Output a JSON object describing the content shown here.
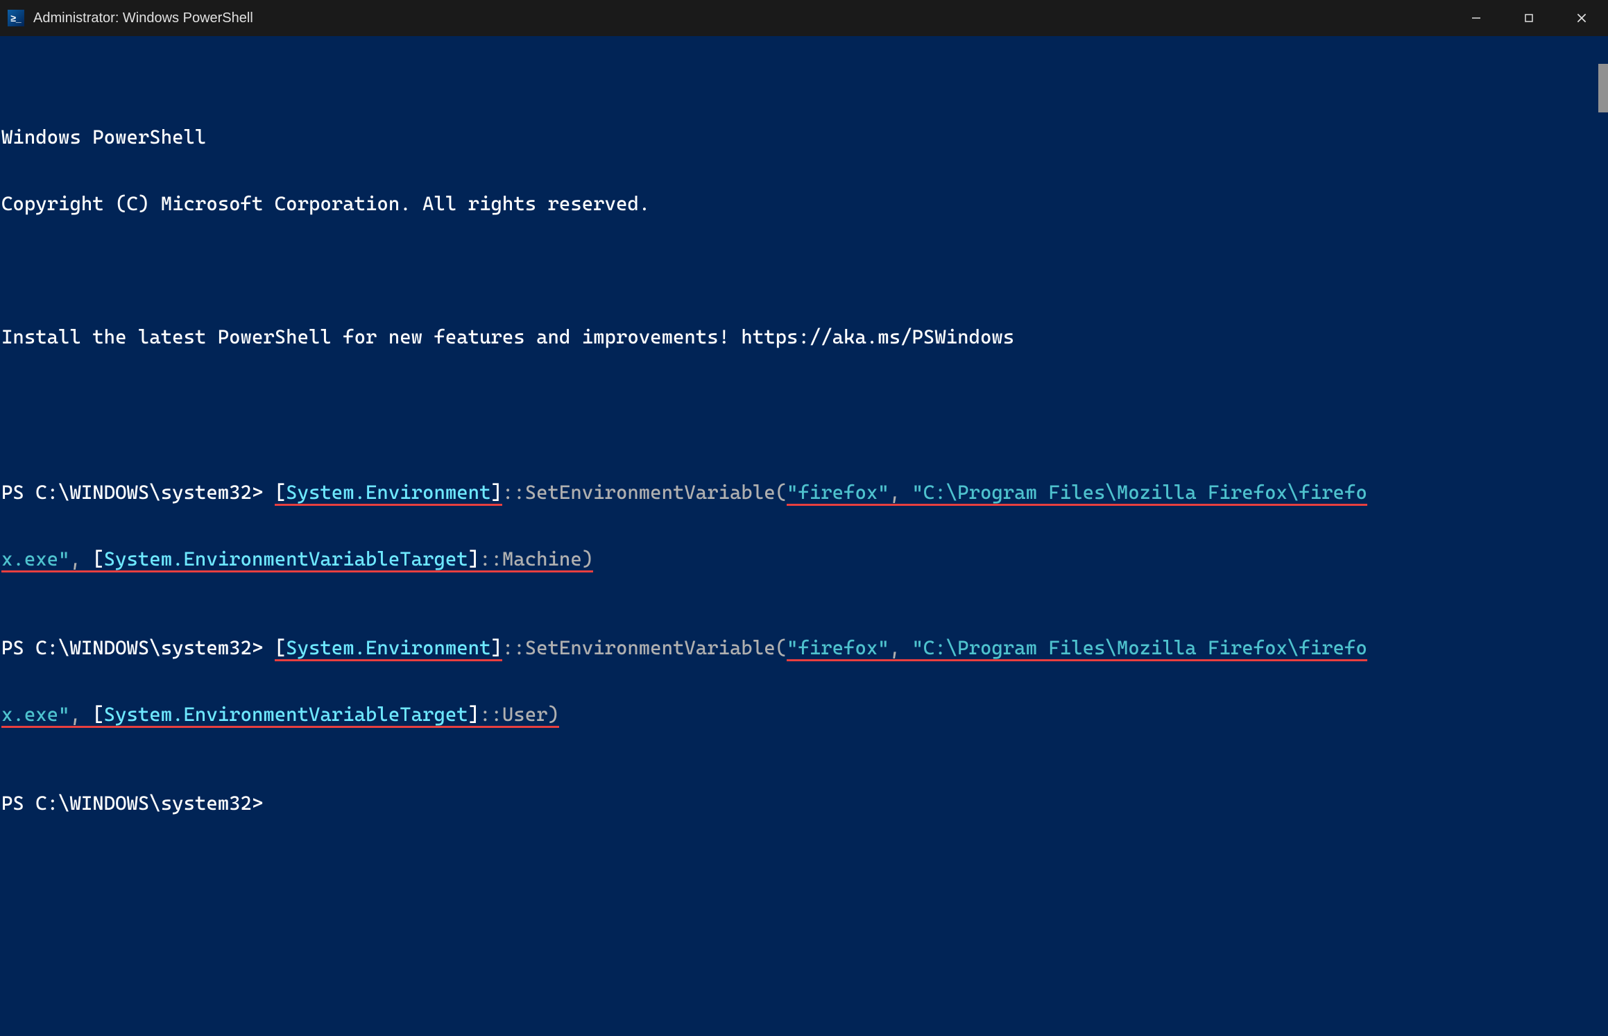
{
  "titlebar": {
    "title": "Administrator: Windows PowerShell"
  },
  "terminal": {
    "banner1": "Windows PowerShell",
    "banner2": "Copyright (C) Microsoft Corporation. All rights reserved.",
    "banner3": "Install the latest PowerShell for new features and improvements! https://aka.ms/PSWindows",
    "prompt": "PS C:\\WINDOWS\\system32> ",
    "cmd1": {
      "sysenv_open": "[",
      "sysenv": "System.Environment",
      "sysenv_close": "]",
      "method": "::SetEnvironmentVariable(",
      "str1": "\"firefox\"",
      "comma1": ", ",
      "str2_a": "\"C:\\Program Files\\Mozilla Firefox\\firefo",
      "str2_b": "x.exe\"",
      "comma2": ", ",
      "target_open": "[",
      "target": "System.EnvironmentVariableTarget",
      "target_close": "]",
      "scope": "::Machine)"
    },
    "cmd2": {
      "sysenv_open": "[",
      "sysenv": "System.Environment",
      "sysenv_close": "]",
      "method": "::SetEnvironmentVariable(",
      "str1": "\"firefox\"",
      "comma1": ", ",
      "str2_a": "\"C:\\Program Files\\Mozilla Firefox\\firefo",
      "str2_b": "x.exe\"",
      "comma2": ", ",
      "target_open": "[",
      "target": "System.EnvironmentVariableTarget",
      "target_close": "]",
      "scope": "::User)"
    }
  }
}
